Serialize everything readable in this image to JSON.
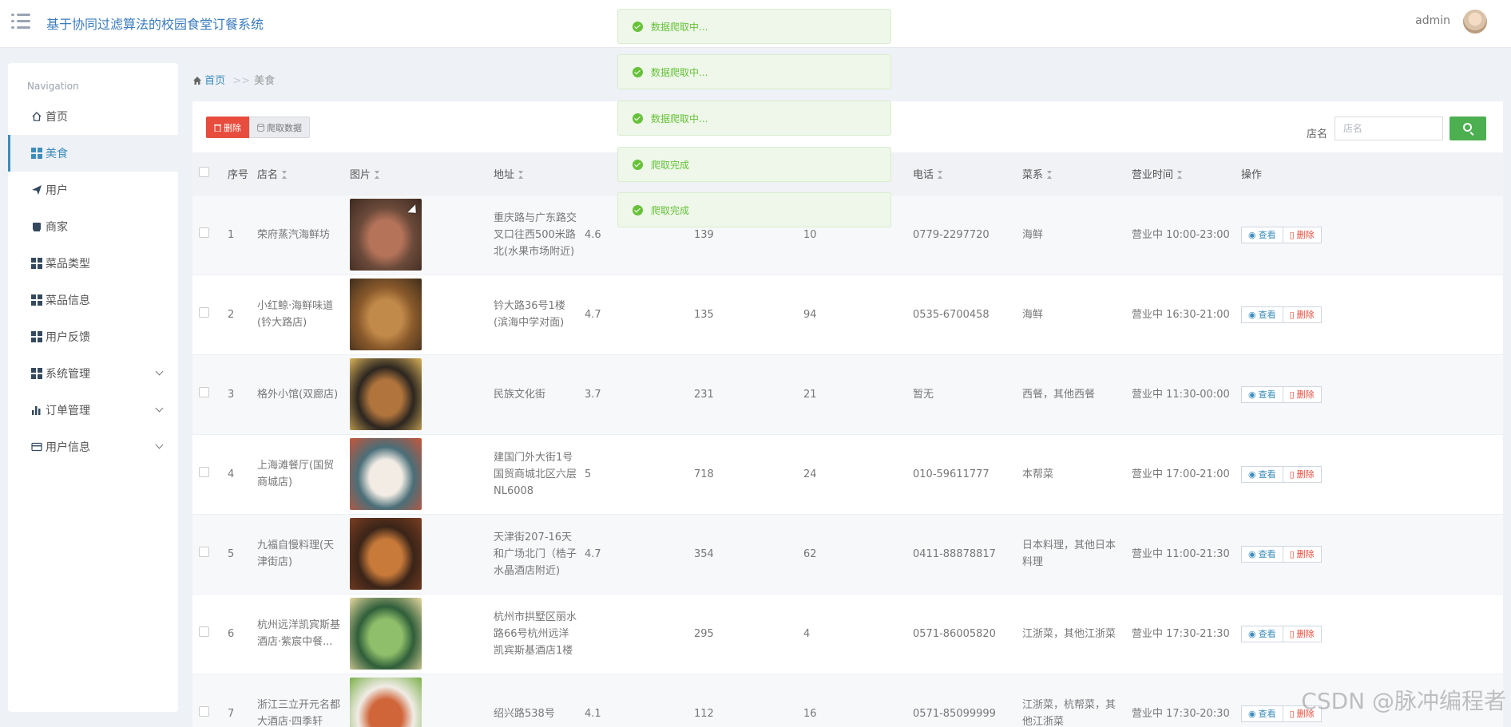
{
  "app": {
    "title": "基于协同过滤算法的校园食堂订餐系统",
    "user": "admin"
  },
  "sidebar": {
    "heading": "Navigation",
    "items": [
      {
        "label": "首页",
        "icon": "home-icon"
      },
      {
        "label": "美食",
        "icon": "grid-icon",
        "active": true
      },
      {
        "label": "用户",
        "icon": "paper-plane-icon"
      },
      {
        "label": "商家",
        "icon": "store-icon"
      },
      {
        "label": "菜品类型",
        "icon": "grid-icon"
      },
      {
        "label": "菜品信息",
        "icon": "grid-icon"
      },
      {
        "label": "用户反馈",
        "icon": "grid-icon"
      },
      {
        "label": "系统管理",
        "icon": "grid-icon",
        "expandable": true
      },
      {
        "label": "订单管理",
        "icon": "bar-chart-icon",
        "expandable": true
      },
      {
        "label": "用户信息",
        "icon": "card-icon",
        "expandable": true
      }
    ]
  },
  "breadcrumb": {
    "home": "首页",
    "sep": ">>",
    "current": "美食"
  },
  "toolbar": {
    "delete_label": "删除",
    "crawl_label": "爬取数据",
    "search_label": "店名",
    "search_placeholder": "店名"
  },
  "table": {
    "columns": [
      "序号",
      "店名",
      "图片",
      "地址",
      "",
      "",
      "",
      "电话",
      "菜系",
      "营业时间",
      "操作"
    ],
    "rows": [
      {
        "no": "1",
        "name": "荣府蒸汽海鲜坊",
        "address": "重庆路与广东路交叉口往西500米路北(水果市场附近)",
        "score": "4.6",
        "c2": "139",
        "c3": "10",
        "phone": "0779-2297720",
        "cuisine": "海鲜",
        "hours": "营业中 10:00-23:00",
        "img_colors": [
          "#6b4a3a",
          "#b5735a",
          "#3d2a20"
        ]
      },
      {
        "no": "2",
        "name": "小红鲸·海鲜味道(钤大路店)",
        "address": "钤大路36号1楼(滨海中学对面)",
        "score": "4.7",
        "c2": "135",
        "c3": "94",
        "phone": "0535-6700458",
        "cuisine": "海鲜",
        "hours": "营业中 16:30-21:00",
        "img_colors": [
          "#8a5a2b",
          "#c28a4a",
          "#3f2e1c"
        ]
      },
      {
        "no": "3",
        "name": "格外小馆(双廊店)",
        "address": "民族文化街",
        "score": "3.7",
        "c2": "231",
        "c3": "21",
        "phone": "暂无",
        "cuisine": "西餐，其他西餐",
        "hours": "营业中 11:30-00:00",
        "img_colors": [
          "#2c2620",
          "#b0743c",
          "#d9b25a"
        ]
      },
      {
        "no": "4",
        "name": "上海滩餐厅(国贸商城店)",
        "address": "建国门外大街1号国贸商城北区六层NL6008",
        "score": "5",
        "c2": "718",
        "c3": "24",
        "phone": "010-59611777",
        "cuisine": "本帮菜",
        "hours": "营业中 17:00-21:00",
        "img_colors": [
          "#4a6e78",
          "#f2ece4",
          "#c8553a"
        ]
      },
      {
        "no": "5",
        "name": "九福自慢料理(天津街店)",
        "address": "天津街207-16天和广场北门（梏子水晶酒店附近)",
        "score": "4.7",
        "c2": "354",
        "c3": "62",
        "phone": "0411-88878817",
        "cuisine": "日本料理，其他日本料理",
        "hours": "营业中 11:00-21:30",
        "img_colors": [
          "#3a2418",
          "#c87a3a",
          "#7a3e22"
        ]
      },
      {
        "no": "6",
        "name": "杭州远洋凯宾斯基酒店·紫宸中餐...",
        "address": "杭州市拱墅区丽水路66号杭州远洋凯宾斯基酒店1楼",
        "score": "",
        "c2": "295",
        "c3": "4",
        "phone": "0571-86005820",
        "cuisine": "江浙菜，其他江浙菜",
        "hours": "营业中 17:30-21:30",
        "img_colors": [
          "#2f5e3a",
          "#8fbf6a",
          "#e8d9a0"
        ]
      },
      {
        "no": "7",
        "name": "浙江三立开元名都大酒店·四季轩",
        "address": "绍兴路538号",
        "score": "4.1",
        "c2": "112",
        "c3": "16",
        "phone": "0571-85099999",
        "cuisine": "江浙菜，杭帮菜，其他江浙菜",
        "hours": "营业中 17:30-20:30",
        "img_colors": [
          "#f0ece6",
          "#d0653a",
          "#7ab04a"
        ]
      }
    ],
    "view_label": "查看",
    "delete_label": "删除"
  },
  "toasts": [
    "数据爬取中...",
    "数据爬取中...",
    "数据爬取中...",
    "爬取完成",
    "爬取完成"
  ],
  "watermark": "CSDN @脉冲编程者",
  "colors": {
    "accent": "#3c8dbc",
    "danger": "#e74c3c",
    "success": "#4caf50",
    "toast": "#67c23a"
  }
}
